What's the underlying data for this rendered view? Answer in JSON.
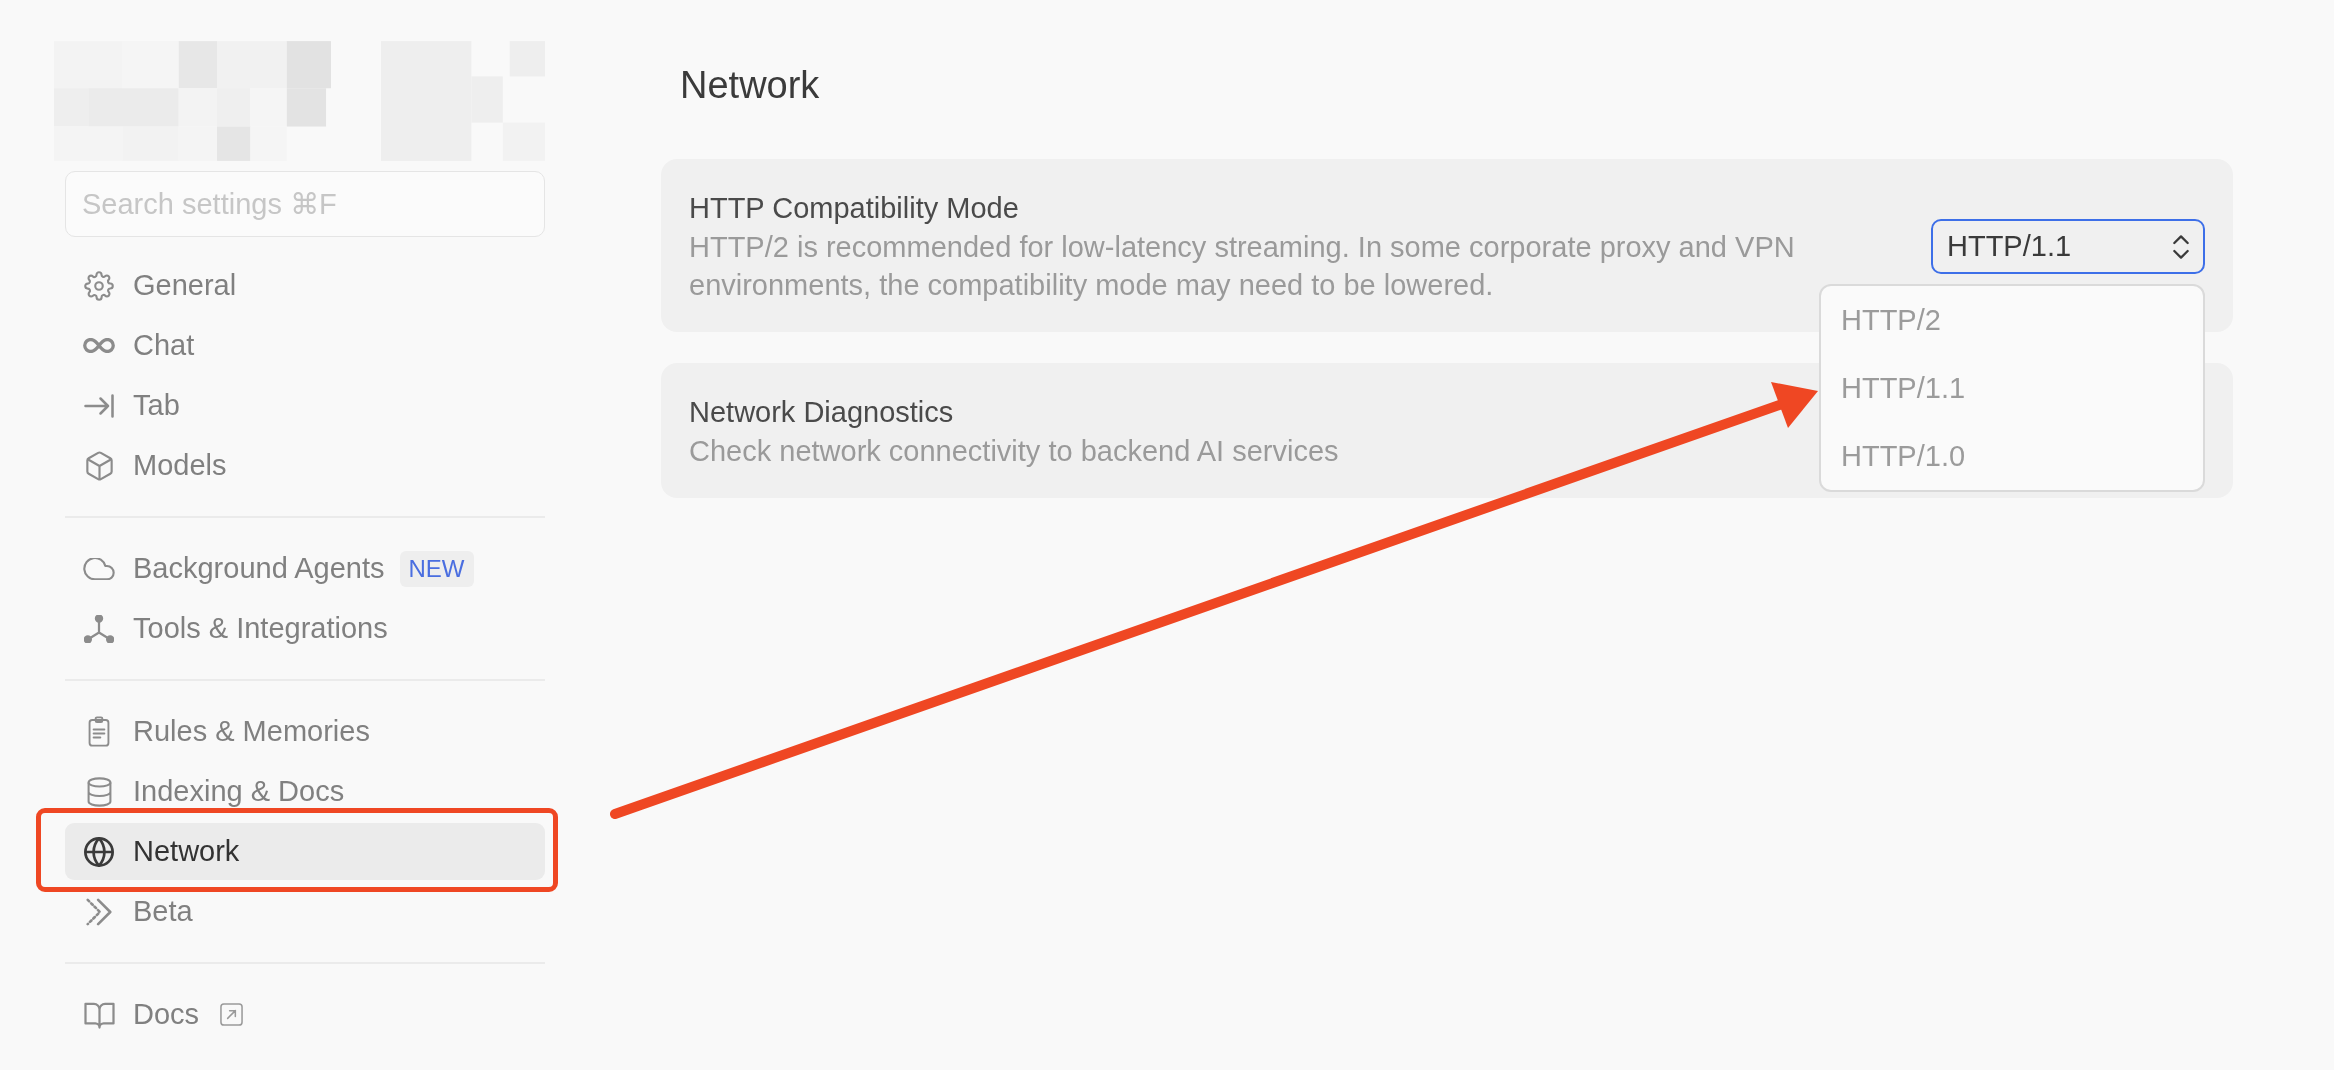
{
  "sidebar": {
    "search": {
      "placeholder": "Search settings ⌘F"
    },
    "sections": [
      {
        "items": [
          {
            "label": "General",
            "selected": false,
            "annotated": false,
            "external": false
          },
          {
            "label": "Chat",
            "selected": false,
            "annotated": false,
            "external": false
          },
          {
            "label": "Tab",
            "selected": false,
            "annotated": false,
            "external": false
          },
          {
            "label": "Models",
            "selected": false,
            "annotated": false,
            "external": false
          }
        ]
      },
      {
        "items": [
          {
            "label": "Background Agents",
            "badge": "NEW",
            "selected": false,
            "annotated": false,
            "external": false
          },
          {
            "label": "Tools & Integrations",
            "selected": false,
            "annotated": false,
            "external": false
          }
        ]
      },
      {
        "items": [
          {
            "label": "Rules & Memories",
            "selected": false,
            "annotated": false,
            "external": false
          },
          {
            "label": "Indexing & Docs",
            "selected": false,
            "annotated": false,
            "external": false
          },
          {
            "label": "Network",
            "selected": true,
            "annotated": true,
            "external": false
          },
          {
            "label": "Beta",
            "selected": false,
            "annotated": false,
            "external": false
          }
        ]
      },
      {
        "items": [
          {
            "label": "Docs",
            "selected": false,
            "annotated": false,
            "external": true
          }
        ]
      }
    ]
  },
  "page": {
    "title": "Network"
  },
  "settings": [
    {
      "kind": "select",
      "title": "HTTP Compatibility Mode",
      "description": "HTTP/2 is recommended for low-latency streaming. In some corporate proxy and VPN environments, the compatibility mode may need to be lowered.",
      "value": "HTTP/1.1",
      "expanded": true,
      "options": [
        "HTTP/2",
        "HTTP/1.1",
        "HTTP/1.0"
      ]
    },
    {
      "kind": "info",
      "title": "Network Diagnostics",
      "description": "Check network connectivity to backend AI services"
    }
  ],
  "annotations": [
    {
      "kind": "arrow"
    }
  ]
}
